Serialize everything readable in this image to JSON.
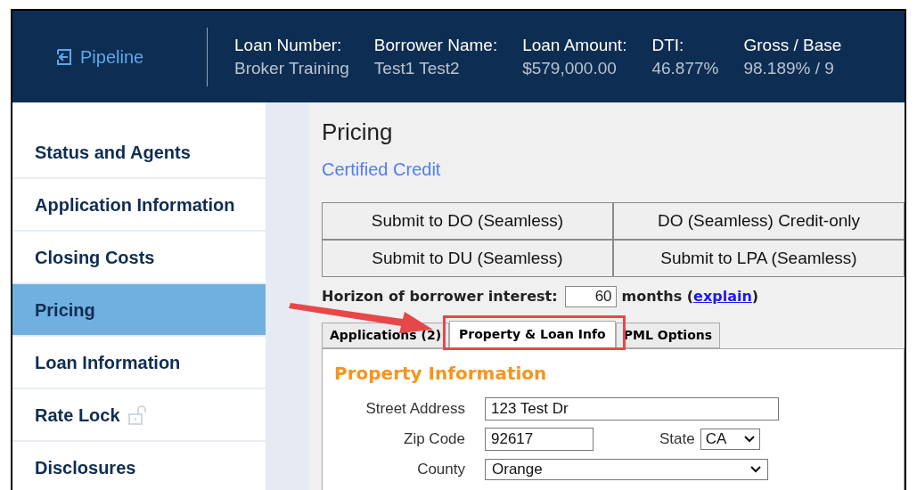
{
  "header": {
    "back_link": "Pipeline",
    "fields": [
      {
        "label": "Loan Number:",
        "value": "Broker Training"
      },
      {
        "label": "Borrower Name:",
        "value": "Test1 Test2"
      },
      {
        "label": "Loan Amount:",
        "value": "$579,000.00"
      },
      {
        "label": "DTI:",
        "value": "46.877%"
      },
      {
        "label": "Gross / Base",
        "value": "98.189% / 9"
      }
    ]
  },
  "sidebar": {
    "items": [
      {
        "label": "Status and Agents",
        "selected": false
      },
      {
        "label": "Application Information",
        "selected": false
      },
      {
        "label": "Closing Costs",
        "selected": false
      },
      {
        "label": "Pricing",
        "selected": true
      },
      {
        "label": "Loan Information",
        "selected": false
      },
      {
        "label": "Rate Lock",
        "selected": false,
        "locked": false
      },
      {
        "label": "Disclosures",
        "selected": false
      }
    ]
  },
  "main": {
    "title": "Pricing",
    "link": "Certified Credit",
    "buttons": [
      "Submit to DO (Seamless)",
      "DO (Seamless) Credit-only",
      "Submit to DU (Seamless)",
      "Submit to LPA (Seamless)"
    ],
    "horizon": {
      "label": "Horizon of borrower interest:",
      "value": "60",
      "unit": "months (",
      "link": "explain",
      "close": ")"
    },
    "tabs": [
      {
        "label": "Applications (2)",
        "selected": false,
        "highlighted": false
      },
      {
        "label": "Property & Loan Info",
        "selected": true,
        "highlighted": true
      },
      {
        "label": "PML Options",
        "selected": false,
        "highlighted": false
      }
    ],
    "section_title": "Property Information",
    "form": {
      "street_address": {
        "label": "Street Address",
        "value": "123 Test Dr"
      },
      "zip_code": {
        "label": "Zip Code",
        "value": "92617"
      },
      "state": {
        "label": "State",
        "value": "CA"
      },
      "county": {
        "label": "County",
        "value": "Orange"
      }
    }
  }
}
